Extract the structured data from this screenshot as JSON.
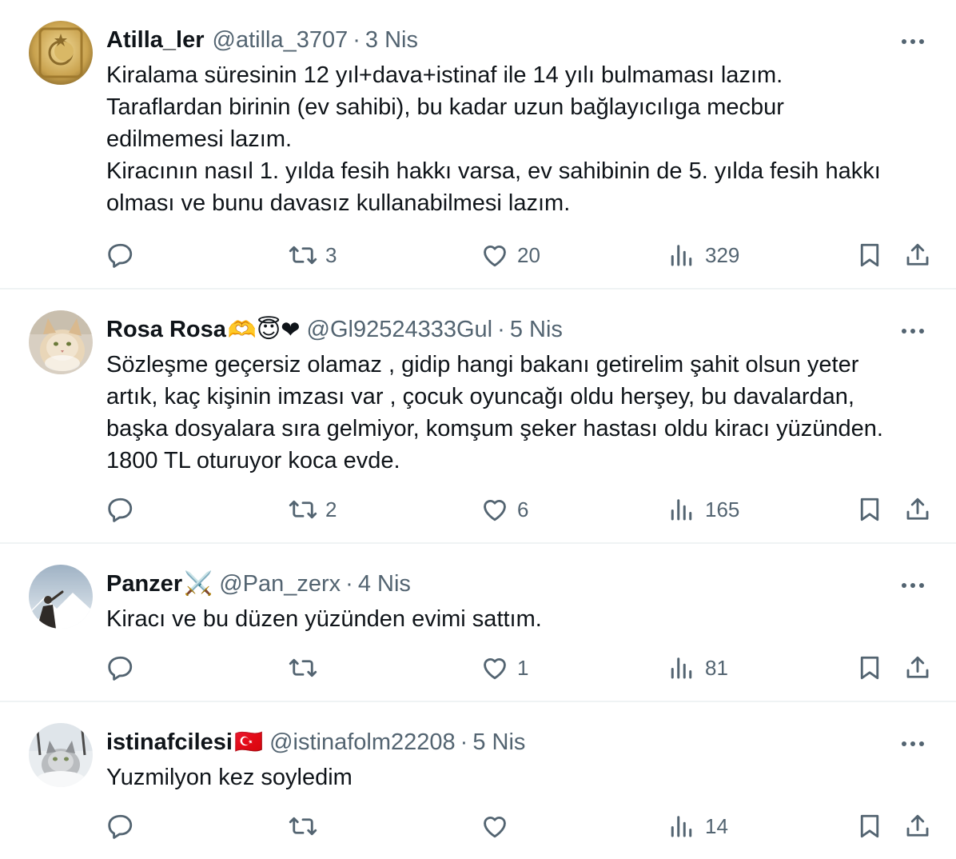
{
  "posts": [
    {
      "name": "Atilla_ler",
      "emoji": "",
      "handle": "@atilla_3707",
      "dot": "·",
      "date": "3 Nis",
      "lines": [
        "Kiralama süresinin 12 yıl+dava+istinaf ile 14 yılı bulmaması lazım.",
        "Taraflardan birinin (ev sahibi), bu kadar uzun bağlayıcılıga mecbur",
        "edilmemesi lazım.",
        "Kiracının nasıl 1. yılda fesih hakkı varsa, ev sahibinin de 5. yılda fesih hakkı",
        "olması ve bunu davasız kullanabilmesi lazım."
      ],
      "replies": "",
      "reposts": "3",
      "likes": "20",
      "views": "329"
    },
    {
      "name": "Rosa Rosa",
      "emoji": "🫶😇❤",
      "handle": "@Gl92524333Gul",
      "dot": "·",
      "date": "5 Nis",
      "lines": [
        "Sözleşme geçersiz olamaz , gidip hangi bakanı getirelim şahit olsun yeter",
        "artık, kaç kişinin imzası var , çocuk oyuncağı oldu herşey, bu davalardan,",
        "başka dosyalara sıra gelmiyor, komşum şeker hastası oldu kiracı yüzünden.",
        "1800 TL oturuyor koca evde."
      ],
      "replies": "",
      "reposts": "2",
      "likes": "6",
      "views": "165"
    },
    {
      "name": "Panzer",
      "emoji": "⚔️",
      "handle": "@Pan_zerx",
      "dot": "·",
      "date": "4 Nis",
      "lines": [
        "Kiracı ve bu düzen yüzünden evimi sattım."
      ],
      "replies": "",
      "reposts": "",
      "likes": "1",
      "views": "81"
    },
    {
      "name": "istinafcilesi",
      "emoji": "🇹🇷",
      "handle": "@istinafolm22208",
      "dot": "·",
      "date": "5 Nis",
      "lines": [
        "Yuzmilyon kez soyledim"
      ],
      "replies": "",
      "reposts": "",
      "likes": "",
      "views": "14"
    }
  ],
  "icons": {
    "reply": "reply-icon",
    "repost": "repost-icon",
    "like": "like-icon",
    "views": "views-icon",
    "bookmark": "bookmark-icon",
    "share": "share-icon",
    "more": "more-icon"
  },
  "colors": {
    "text": "#0f1419",
    "secondary": "#536471",
    "divider": "#eff3f4"
  }
}
